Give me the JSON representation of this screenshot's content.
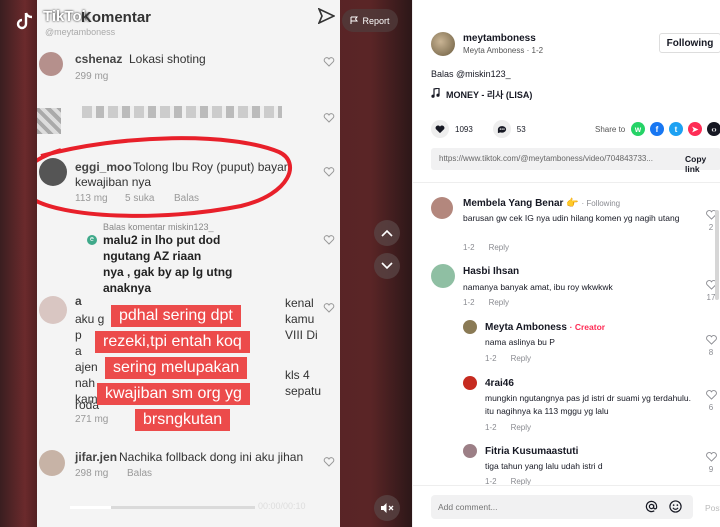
{
  "player": {
    "overlay_title": "Komentar",
    "watermark_top": "TikTok",
    "watermark_user": "@meytamboness",
    "report_label": "Report",
    "time": "00:00/00:10",
    "progress_fraction": 0.22,
    "comments": [
      {
        "name": "cshenaz",
        "text": "Lokasi shoting",
        "meta": "299 mg"
      },
      {
        "name": "eggi_moo",
        "text": "Tolong Ibu Roy (puput) bayar",
        "text2": "kewajiban nya",
        "meta": "113 mg",
        "likes": "5 suka",
        "reply": "Balas"
      },
      {
        "reply_header": "Balas komentar miskin123_",
        "badge": "e",
        "line1": "malu2 in lho put dod",
        "line2": "ngutang AZ    riaan",
        "line3": "nya , gak by    ap lg utng",
        "line4": "anaknya"
      },
      {
        "name": "a",
        "text": "kenal",
        "text_b": "aku g",
        "text_c": "kamu",
        "text_d": "p",
        "text_e": "VIII Di",
        "text_f": "a",
        "text_g": "ajen",
        "text_h": "n",
        "text_i": "nah",
        "text_j": "kls 4",
        "text_k": "kam",
        "text_l": "sepatu",
        "text_m": "roda",
        "meta": "271 mg"
      },
      {
        "name": "jifar.jen",
        "text": "Nachika follback dong ini aku jihan",
        "meta": "298 mg",
        "reply": "Balas"
      }
    ],
    "captions": [
      "pdhal sering dpt",
      "rezeki,tpi entah koq",
      "sering melupakan",
      "kwajiban sm org yg",
      "brsngkutan"
    ]
  },
  "panel": {
    "author": {
      "name": "meytamboness",
      "display": "Meyta Amboness",
      "date": "1-2"
    },
    "follow_label": "Following",
    "description": {
      "prefix": "Balas",
      "mention": "@miskin123_"
    },
    "music": "MONEY - 리사 (LISA)",
    "likes": "1093",
    "comments_count": "53",
    "share_label": "Share to",
    "link": "https://www.tiktok.com/@meytamboness/video/704843733...",
    "copy_label": "Copy link",
    "comments": [
      {
        "name": "Membela Yang Benar",
        "emoji": "👉",
        "badge": "Following",
        "text": "barusan gw cek IG nya udin hilang komen yg nagih utang",
        "date": "1-2",
        "reply": "Reply",
        "likes": "2"
      },
      {
        "name": "Hasbi Ihsan",
        "text": "namanya banyak amat, ibu roy wkwkwk",
        "date": "1-2",
        "reply": "Reply",
        "likes": "17"
      },
      {
        "name": "Meyta Amboness",
        "badge": "Creator",
        "text": "nama aslinya bu P",
        "date": "1-2",
        "reply": "Reply",
        "likes": "8"
      },
      {
        "name": "4rai46",
        "text": "mungkin ngutangnya pas jd istri dr suami yg terdahulu. itu nagihnya ka 113 mggu yg lalu",
        "date": "1-2",
        "reply": "Reply",
        "likes": "6"
      },
      {
        "name": "Fitria Kusumaastuti",
        "text": "tiga tahun yang lalu udah istri d",
        "date": "1-2",
        "reply": "Reply",
        "likes": "9"
      }
    ],
    "comment_placeholder": "Add comment...",
    "post_label": "Post"
  },
  "colors": {
    "accent": "#fe2c55",
    "caption_bg": "#ec4b4b"
  }
}
